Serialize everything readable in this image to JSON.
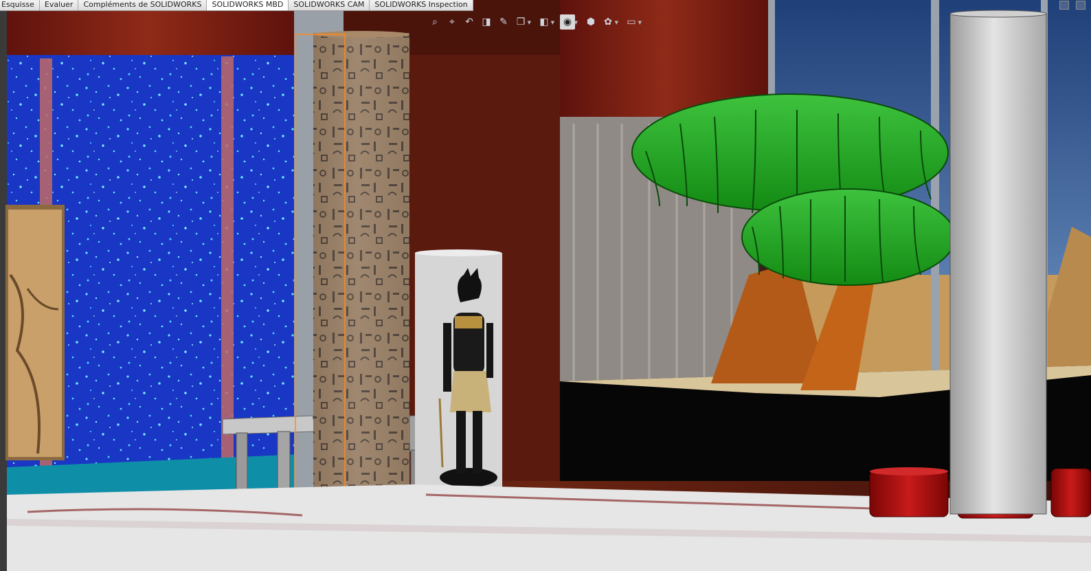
{
  "command_tabs": [
    {
      "label": "Esquisse",
      "active": false
    },
    {
      "label": "Evaluer",
      "active": false
    },
    {
      "label": "Compléments de SOLIDWORKS",
      "active": false
    },
    {
      "label": "SOLIDWORKS MBD",
      "active": true
    },
    {
      "label": "SOLIDWORKS CAM",
      "active": false
    },
    {
      "label": "SOLIDWORKS Inspection",
      "active": false
    }
  ],
  "view_toolbar": [
    {
      "icon": "zoom-to-fit-icon",
      "glyph": "⌕",
      "dropdown": false,
      "selected": false
    },
    {
      "icon": "zoom-to-area-icon",
      "glyph": "⌖",
      "dropdown": false,
      "selected": false
    },
    {
      "icon": "previous-view-icon",
      "glyph": "↶",
      "dropdown": false,
      "selected": false
    },
    {
      "icon": "section-view-icon",
      "glyph": "◨",
      "dropdown": false,
      "selected": false
    },
    {
      "icon": "dynamic-annotation-icon",
      "glyph": "✎",
      "dropdown": false,
      "selected": false
    },
    {
      "icon": "view-orientation-icon",
      "glyph": "❐",
      "dropdown": true,
      "selected": false
    },
    {
      "icon": "display-style-icon",
      "glyph": "◧",
      "dropdown": true,
      "selected": false
    },
    {
      "icon": "hide-show-items-icon",
      "glyph": "◉",
      "dropdown": true,
      "selected": true
    },
    {
      "icon": "edit-appearance-icon",
      "glyph": "⬢",
      "dropdown": false,
      "selected": false
    },
    {
      "icon": "apply-scene-icon",
      "glyph": "✿",
      "dropdown": true,
      "selected": false
    },
    {
      "icon": "view-settings-icon",
      "glyph": "▭",
      "dropdown": true,
      "selected": false
    }
  ],
  "colors": {
    "wall": "#5a1a0e",
    "curtain": "#7a1c14",
    "aquarium": "#1838c8",
    "palm_leaf": "#1f9a1f",
    "palm_trunk": "#b35a18",
    "sand": "#d9c59a",
    "stool": "#b01010",
    "column": "#c8c8c8",
    "floor": "#e8e8e8"
  }
}
